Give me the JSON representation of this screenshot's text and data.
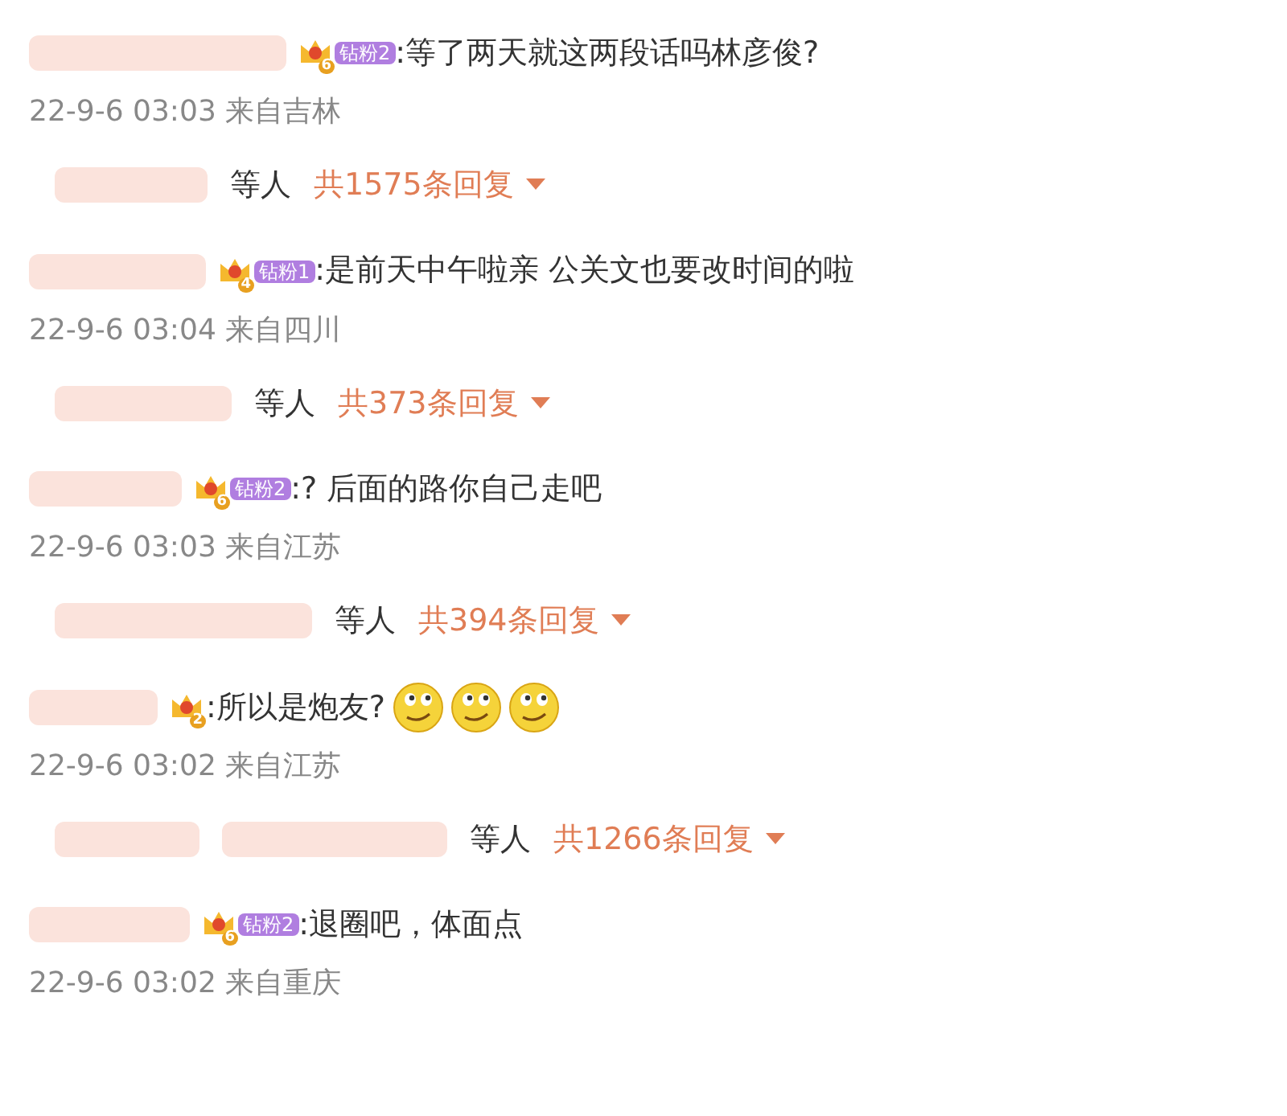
{
  "comments": [
    {
      "crown_level": "6",
      "fan_badge": "钻粉2",
      "text": ":等了两天就这两段话吗林彦俊?",
      "meta": "22-9-6 03:03 来自吉林",
      "replies": {
        "suffix": "等人",
        "count": "共1575条回复"
      }
    },
    {
      "crown_level": "4",
      "fan_badge": "钻粉1",
      "text": ":是前天中午啦亲 公关文也要改时间的啦",
      "meta": "22-9-6 03:04 来自四川",
      "replies": {
        "suffix": "等人",
        "count": "共373条回复"
      }
    },
    {
      "crown_level": "6",
      "fan_badge": "钻粉2",
      "text": ":? 后面的路你自己走吧",
      "meta": "22-9-6 03:03 来自江苏",
      "replies": {
        "suffix": "等人",
        "count": "共394条回复"
      }
    },
    {
      "crown_level": "2",
      "text": ":所以是炮友?",
      "emojis": [
        {
          "kind": "smirk"
        },
        {
          "kind": "smirk"
        },
        {
          "kind": "smirk"
        }
      ],
      "meta": "22-9-6 03:02 来自江苏",
      "replies": {
        "suffix": "等人",
        "count": "共1266条回复"
      }
    },
    {
      "crown_level": "6",
      "fan_badge": "钻粉2",
      "text": ":退圈吧，体面点",
      "meta": "22-9-6 03:02 来自重庆"
    }
  ]
}
